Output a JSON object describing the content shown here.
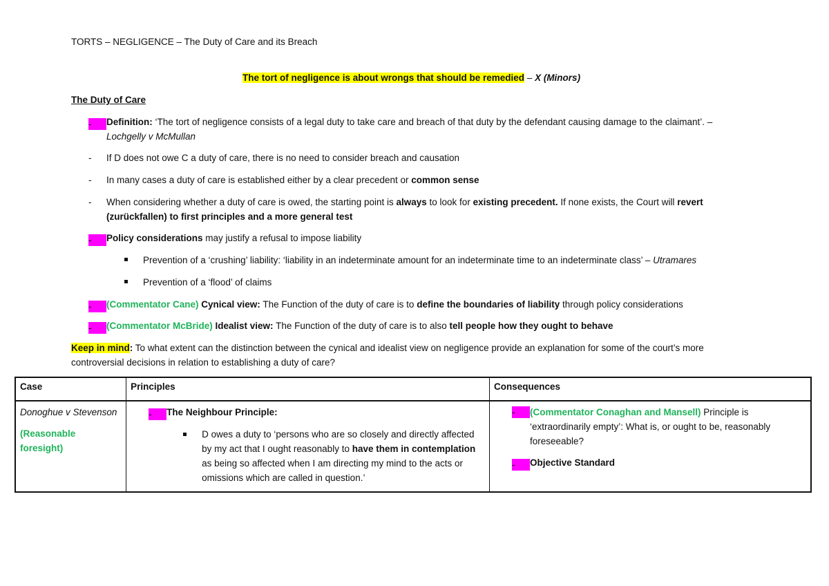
{
  "header": {
    "title": "TORTS – NEGLIGENCE – The Duty of Care and its Breach"
  },
  "quote": {
    "text": "The tort of negligence is about wrongs that should be remedied",
    "sep": " – ",
    "source": "X (Minors)"
  },
  "section": {
    "heading": "The Duty of Care"
  },
  "points": {
    "definition": {
      "label": "Definition:",
      "text": " ‘The tort of negligence consists of a legal duty to take care and breach of that duty by the defendant causing damage to the claimant’. –",
      "source": "Lochgelly v McMullan"
    },
    "no_duty": "If D does not owe C a duty of care, there is no need to consider breach and causation",
    "many_cases": {
      "text": "In many cases a duty of care is established either by a clear precedent or ",
      "bold": "common sense"
    },
    "considering": {
      "t1": "When considering whether a duty of care is owed, the starting point is ",
      "b1": "always",
      "t2": " to look for ",
      "b2": "existing precedent.",
      "t3": " If none exists, the Court will ",
      "b3": "revert",
      "line2": "(zurückfallen) to first principles and a more general test"
    },
    "policy": {
      "bold": "Policy considerations",
      "text": " may justify a refusal to impose liability",
      "sub": [
        {
          "text": "Prevention of a ‘crushing’ liability: ‘liability in an indeterminate amount for an indeterminate time to an indeterminate class’ – ",
          "source": "Utramares"
        },
        {
          "text": "Prevention of a ‘flood’ of claims"
        }
      ]
    },
    "cane": {
      "commentator": "(Commentator Cane)",
      "label": " Cynical view:",
      "t1": " The Function of the duty of care is to ",
      "b1": "define the boundaries of liability",
      "t2": " through policy considerations"
    },
    "mcbride": {
      "commentator": "(Commentator McBride)",
      "label": " Idealist view:",
      "t1": " The Function of the duty of care is to also ",
      "b1": "tell people how they ought to behave"
    },
    "dash": "-"
  },
  "keep_in_mind": {
    "label": "Keep in mind",
    "colon": ":",
    "line1": " To what extent can the distinction between the cynical and idealist view on negligence provide an explanation for some of the court’s more",
    "line2": "controversial decisions in relation to establishing a duty of care?"
  },
  "table": {
    "headers": [
      "Case",
      "Principles",
      "Consequences"
    ],
    "rows": [
      {
        "case": "Donoghue v Stevenson",
        "case_note": "(Reasonable foresight)",
        "principle_title": "The Neighbour Principle:",
        "principle_quote": {
          "t1": "D owes a duty to ‘persons who are so closely and directly affected by my act that I ought reasonably to ",
          "b1": "have them in contemplation",
          "t2": " as being so affected when I am directing my mind to the acts or omissions which are called in question.’"
        },
        "consequences": [
          {
            "commentator": "(Commentator Conaghan and Mansell)",
            "text": " Principle is ‘extraordinarily empty’: What is, or ought to be, reasonably foreseeable?"
          },
          {
            "bold": "Objective Standard"
          }
        ]
      }
    ]
  },
  "colors": {
    "highlight_yellow": "#ffff00",
    "highlight_magenta": "#ff00ff",
    "commentator_green": "#1fb35a"
  }
}
